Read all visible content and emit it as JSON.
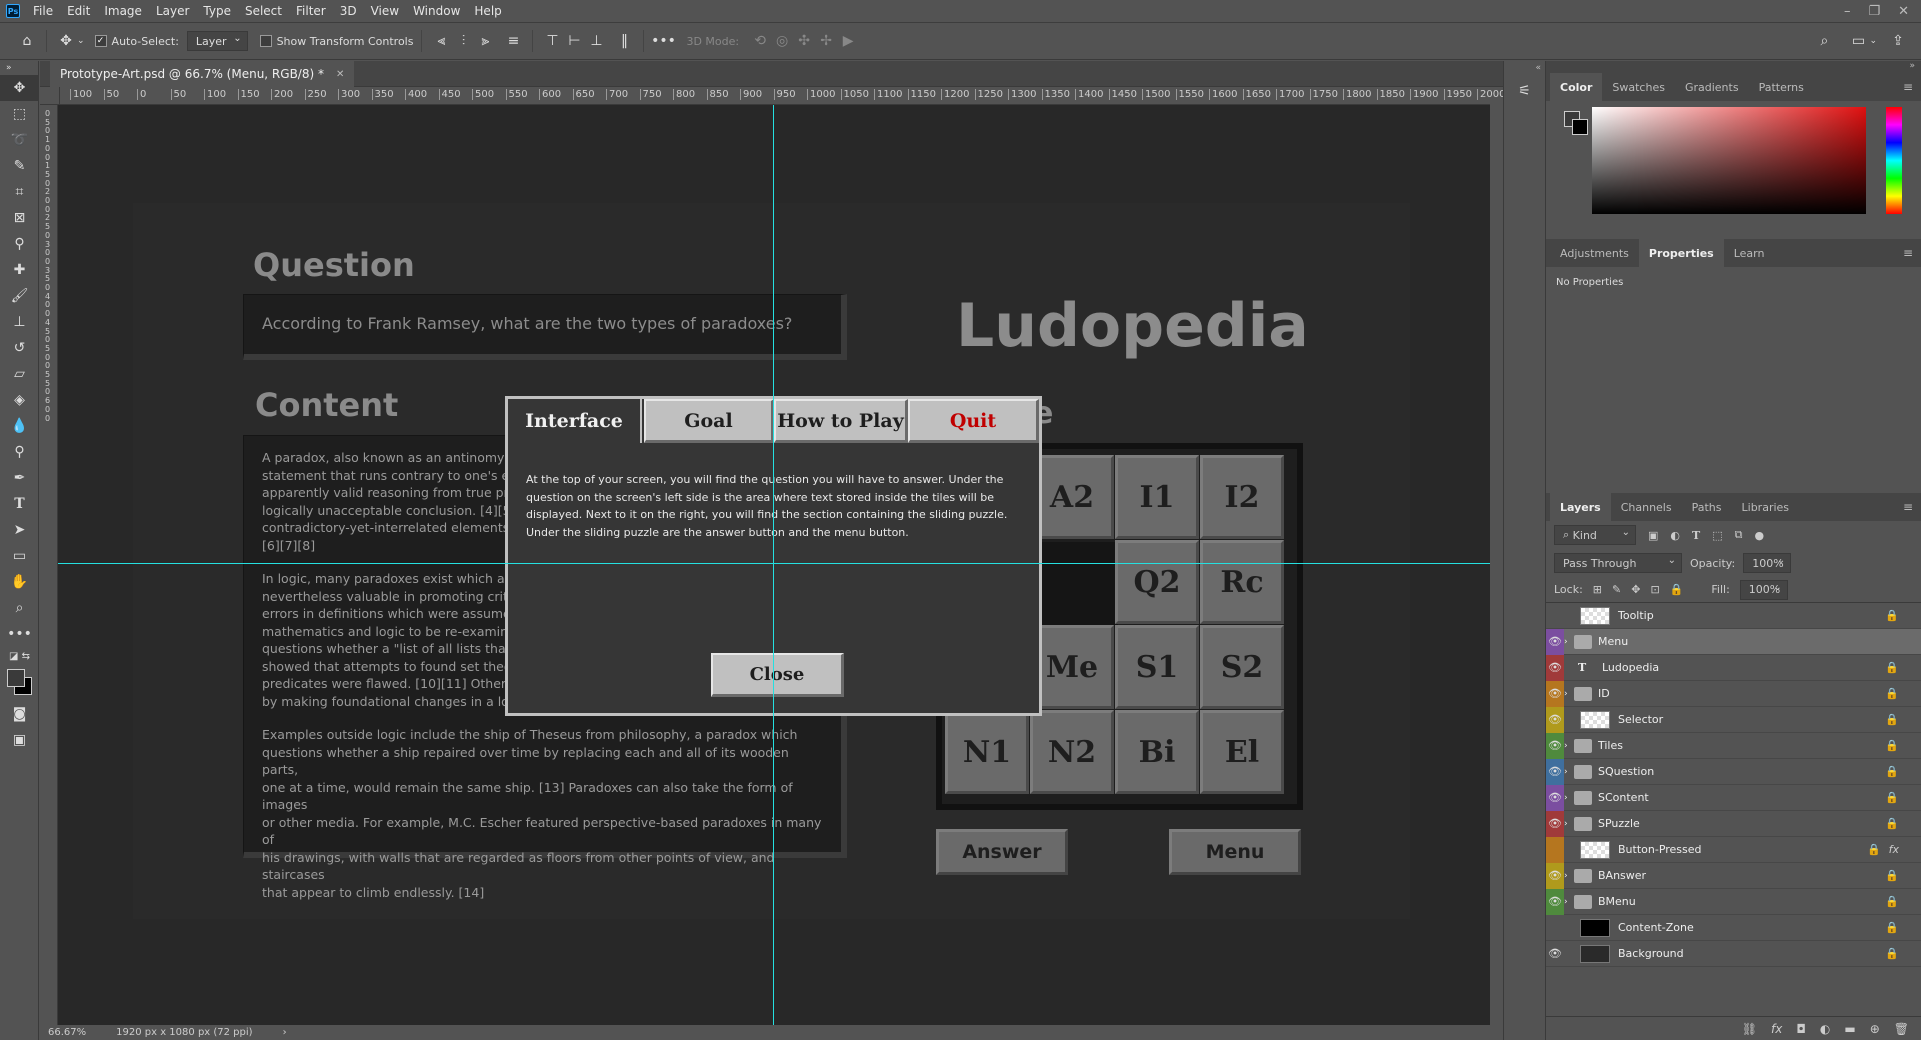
{
  "app": {
    "menu": [
      "File",
      "Edit",
      "Image",
      "Layer",
      "Type",
      "Select",
      "Filter",
      "3D",
      "View",
      "Window",
      "Help"
    ],
    "logo": "Ps"
  },
  "options": {
    "auto_select_label": "Auto-Select:",
    "auto_select_value": "Layer",
    "show_transform_label": "Show Transform Controls",
    "mode_3d_label": "3D Mode:"
  },
  "document": {
    "tab_title": "Prototype-Art.psd @ 66.7% (Menu, RGB/8) *",
    "zoom": "66.67%",
    "dimensions": "1920 px x 1080 px (72 ppi)"
  },
  "ruler": {
    "h_ticks": [
      "100",
      "50",
      "0",
      "50",
      "100",
      "150",
      "200",
      "250",
      "300",
      "350",
      "400",
      "450",
      "500",
      "550",
      "600",
      "650",
      "700",
      "750",
      "800",
      "850",
      "900",
      "950",
      "1000",
      "1050",
      "1100",
      "1150",
      "1200",
      "1250",
      "1300",
      "1350",
      "1400",
      "1450",
      "1500",
      "1550",
      "1600",
      "1650",
      "1700",
      "1750",
      "1800",
      "1850",
      "1900",
      "1950",
      "2000"
    ],
    "v_ticks": [
      "0",
      "5",
      "0",
      "1",
      "0",
      "0",
      "1",
      "5",
      "0",
      "2",
      "0",
      "0",
      "2",
      "5",
      "0",
      "3",
      "0",
      "0",
      "3",
      "5",
      "0",
      "4",
      "0",
      "0",
      "4",
      "5",
      "0",
      "5",
      "0",
      "0",
      "5",
      "5",
      "0",
      "6",
      "0",
      "0"
    ]
  },
  "game": {
    "question_title": "Question",
    "question_text": "According to Frank Ramsey, what are the two types of paradoxes?",
    "content_title": "Content",
    "brand": "Ludopedia",
    "content_p1": [
      "A paradox, also known as an antinomy, is",
      "statement that runs contrary to one's ex",
      "apparently valid reasoning from true pre",
      "logically unacceptable conclusion. [4][5]",
      "contradictory-yet-interrelated elements",
      "[6][7][8]"
    ],
    "content_p2": [
      "In logic, many paradoxes exist which are",
      "nevertheless valuable in promoting critic",
      "errors in definitions which were assumed",
      "mathematics and logic to be re-examined",
      "questions whether a \"list of all lists that",
      "showed that attempts to found set theo",
      "predicates were flawed. [10][11] Others,",
      "by making foundational changes in a log"
    ],
    "content_p3": [
      "Examples outside logic include the ship of Theseus from philosophy, a paradox which",
      "questions whether a ship repaired over time by replacing each and all of its wooden parts,",
      "one at a time, would remain the same ship. [13] Paradoxes can also take the form of images",
      "or other media. For example, M.C. Escher featured perspective-based paradoxes in many of",
      "his drawings, with walls that are regarded as floors from other points of view, and staircases",
      "that appear to climb endlessly. [14]"
    ],
    "puzzle_partial_label": "e",
    "tiles": [
      "A2",
      "I1",
      "I2",
      "Q2",
      "Rc",
      "Me",
      "S1",
      "S2",
      "N1",
      "N2",
      "Bi",
      "El"
    ],
    "answer_button": "Answer",
    "menu_button": "Menu"
  },
  "modal": {
    "tabs": [
      "Interface",
      "Goal",
      "How to Play",
      "Quit"
    ],
    "quit_color": "#c00000",
    "body": [
      "At the top of your screen, you will find the question you will have to answer. Under the",
      "question on the screen's left side is the area where text stored inside the tiles will be",
      "displayed. Next to it on the right, you will find the section containing the sliding puzzle.",
      "Under the sliding puzzle are the answer button and the menu button."
    ],
    "close": "Close"
  },
  "panels": {
    "color_tabs": [
      "Color",
      "Swatches",
      "Gradients",
      "Patterns"
    ],
    "props_tabs": [
      "Adjustments",
      "Properties",
      "Learn"
    ],
    "no_properties": "No Properties",
    "layers_tabs": [
      "Layers",
      "Channels",
      "Paths",
      "Libraries"
    ],
    "kind_label": "Kind",
    "blend_mode": "Pass Through",
    "opacity_label": "Opacity:",
    "opacity_value": "100%",
    "lock_label": "Lock:",
    "fill_label": "Fill:",
    "fill_value": "100%",
    "layers": [
      {
        "name": "Tooltip",
        "vis": false,
        "color": "",
        "kind": "checker",
        "lock": true
      },
      {
        "name": "Menu",
        "vis": true,
        "color": "#7b4ea0",
        "kind": "folder",
        "lock": false,
        "selected": true
      },
      {
        "name": "Ludopedia",
        "vis": true,
        "color": "#a03a3a",
        "kind": "text",
        "lock": true
      },
      {
        "name": "ID",
        "vis": true,
        "color": "#b5761f",
        "kind": "folder",
        "lock": true
      },
      {
        "name": "Selector",
        "vis": true,
        "color": "#b09a1c",
        "kind": "checker",
        "lock": true
      },
      {
        "name": "Tiles",
        "vis": true,
        "color": "#4f8a3d",
        "kind": "folder",
        "lock": true
      },
      {
        "name": "SQuestion",
        "vis": true,
        "color": "#3f6f9e",
        "kind": "folder",
        "lock": true
      },
      {
        "name": "SContent",
        "vis": true,
        "color": "#7b4ea0",
        "kind": "folder",
        "lock": true
      },
      {
        "name": "SPuzzle",
        "vis": true,
        "color": "#a03a3a",
        "kind": "folder",
        "lock": true
      },
      {
        "name": "Button-Pressed",
        "vis": false,
        "color": "#b5761f",
        "kind": "checker",
        "lock": true,
        "fx": true
      },
      {
        "name": "BAnswer",
        "vis": true,
        "color": "#b09a1c",
        "kind": "folder",
        "lock": true
      },
      {
        "name": "BMenu",
        "vis": true,
        "color": "#4f8a3d",
        "kind": "folder",
        "lock": true
      },
      {
        "name": "Content-Zone",
        "vis": false,
        "color": "",
        "kind": "black",
        "lock": true
      },
      {
        "name": "Background",
        "vis": true,
        "color": "",
        "kind": "dark",
        "lock": true
      }
    ]
  }
}
